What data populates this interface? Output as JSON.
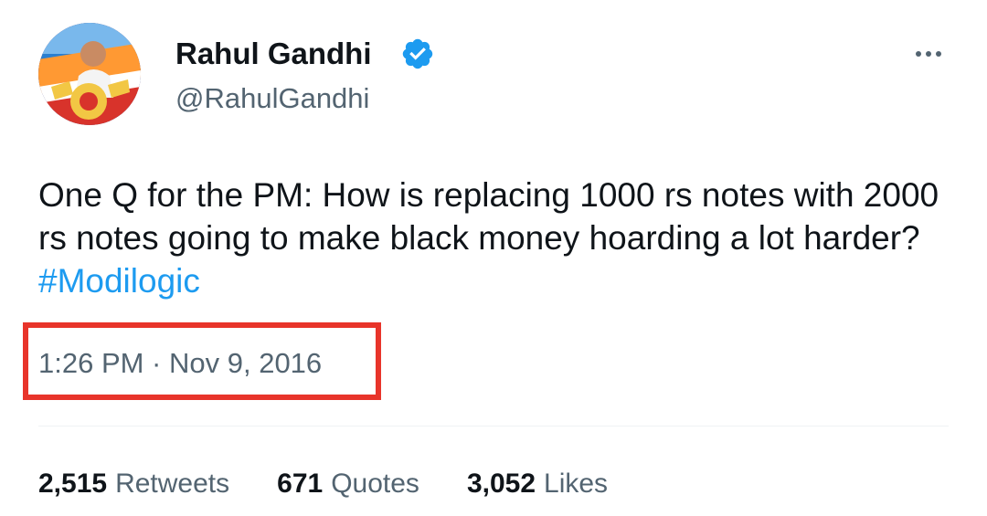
{
  "author": {
    "name": "Rahul Gandhi",
    "handle": "@RahulGandhi",
    "verified": true,
    "avatar_icon": "profile-avatar"
  },
  "tweet": {
    "text_before_hashtag": "One Q for the PM: How is replacing 1000 rs notes with 2000 rs notes going to make black money hoarding a lot harder? ",
    "hashtag": "#Modilogic",
    "timestamp": "1:26 PM · Nov 9, 2016"
  },
  "stats": {
    "retweets_count": "2,515",
    "retweets_label": "Retweets",
    "quotes_count": "671",
    "quotes_label": "Quotes",
    "likes_count": "3,052",
    "likes_label": "Likes"
  },
  "colors": {
    "hashtag": "#1d9bf0",
    "verified": "#1d9bf0",
    "highlight_box": "#e8342a",
    "secondary_text": "#536471"
  },
  "icons": {
    "verified": "verified-badge-icon",
    "more": "more-dots-icon"
  }
}
